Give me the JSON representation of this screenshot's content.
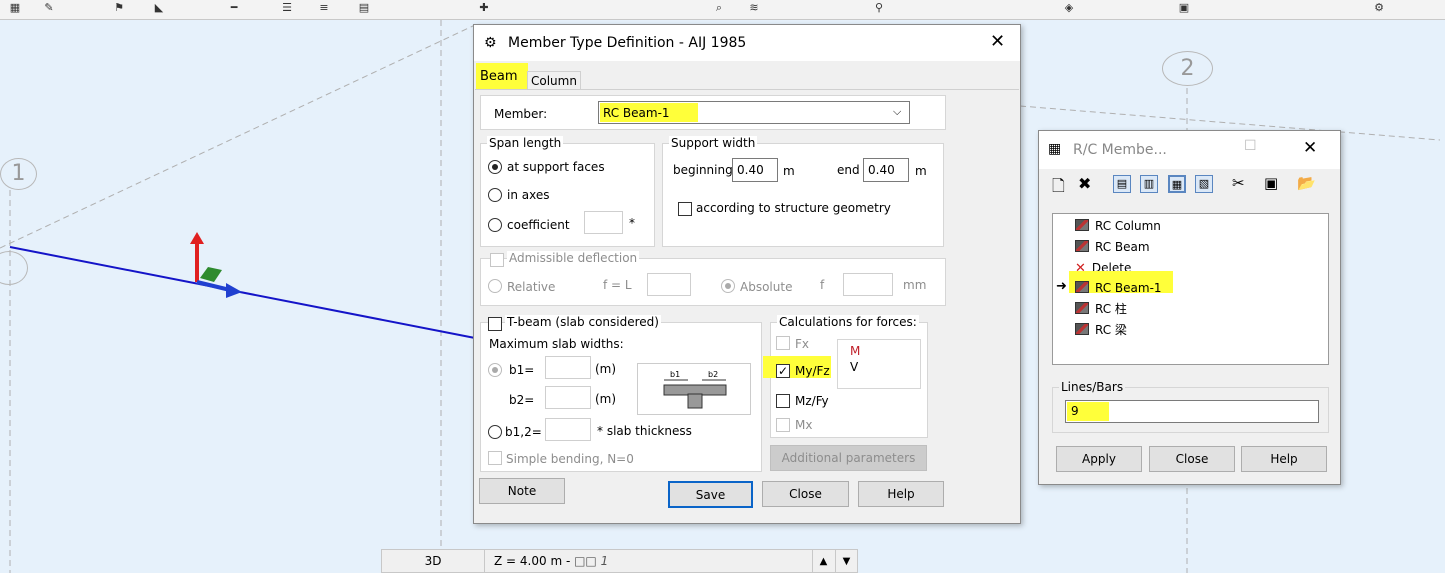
{
  "toolbar": {
    "icons": [
      "grid-icon",
      "pencil-icon",
      "flag-icon",
      "measure-icon",
      "section-icon",
      "table-icon",
      "bars-icon",
      "calc-icon",
      "pin-icon",
      "zoom-icon",
      "spring-icon",
      "probe-icon",
      "fill-icon",
      "cube-icon",
      "filter-icon"
    ]
  },
  "viewport": {
    "grid_labels": [
      "1",
      "2"
    ]
  },
  "member_dialog": {
    "title": "Member Type Definition - AIJ 1985",
    "tabs": [
      "Beam",
      "Column"
    ],
    "member_label": "Member:",
    "member_value": "RC Beam-1",
    "span_length": {
      "title": "Span length",
      "at_support": "at support faces",
      "in_axes": "in axes",
      "coefficient": "coefficient",
      "coef_suffix": "*"
    },
    "support_width": {
      "title": "Support width",
      "beginning": "beginning",
      "beginning_value": "0.40",
      "m1": "m",
      "end": "end",
      "end_value": "0.40",
      "m2": "m",
      "geometry": "according to structure geometry"
    },
    "deflection": {
      "label": "Admissible deflection",
      "relative": "Relative",
      "f_l": "f = L",
      "absolute": "Absolute",
      "f": "f",
      "mm": "mm"
    },
    "tbeam": {
      "label": "T-beam (slab considered)",
      "max_widths": "Maximum slab widths:",
      "b1": "b1=",
      "b2": "b2=",
      "b12": "b1,2=",
      "unit_m1": "(m)",
      "unit_m2": "(m)",
      "slab_thickness": "* slab thickness",
      "simple_bending": "Simple bending, N=0",
      "fig_b1": "b1",
      "fig_b2": "b2"
    },
    "calculations": {
      "title": "Calculations for forces:",
      "fx": "Fx",
      "myfz": "My/Fz",
      "mzfy": "Mz/Fy",
      "mx": "Mx",
      "m": "M",
      "v": "V",
      "additional": "Additional parameters"
    },
    "buttons": {
      "note": "Note",
      "save": "Save",
      "close": "Close",
      "help": "Help"
    }
  },
  "rc_panel": {
    "title": "R/C Membe...",
    "tree": [
      "RC Column",
      "RC Beam",
      "Delete",
      "RC Beam-1",
      "RC 柱",
      "RC 梁"
    ],
    "lines_label": "Lines/Bars",
    "lines_value": "9",
    "buttons": {
      "apply": "Apply",
      "close": "Close",
      "help": "Help"
    }
  },
  "statusbar": {
    "view": "3D",
    "z_label": "Z = 4.00 m - ",
    "z_suffix": "□□ 1"
  },
  "colors": {
    "highlight": "#ffff3a",
    "beam_line": "#1414c8",
    "axis_red": "#e02020",
    "axis_green": "#2e8b2e",
    "axis_blue": "#2040d0"
  }
}
